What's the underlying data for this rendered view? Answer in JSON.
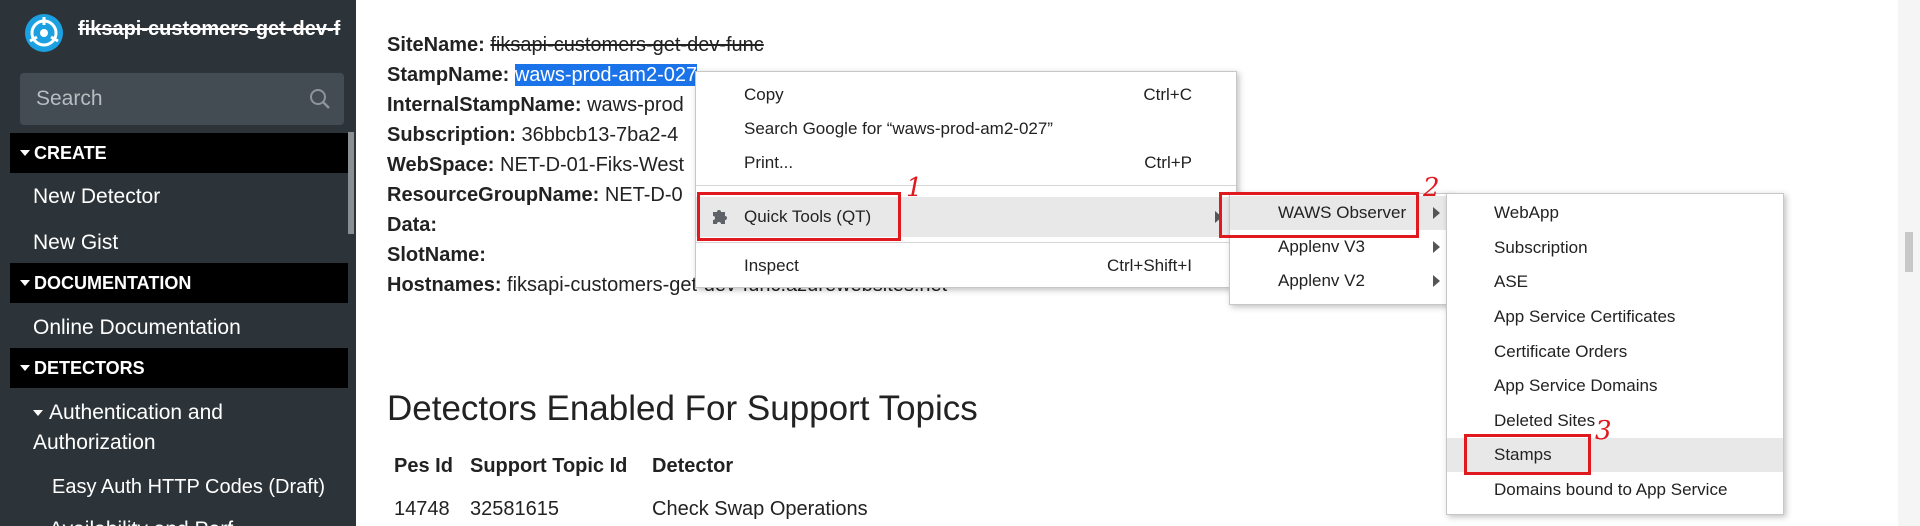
{
  "sidebar": {
    "app_title": "fiksapi-customers-get-dev-f",
    "search_placeholder": "Search",
    "create_header": "CREATE",
    "create_items": [
      "New Detector",
      "New Gist"
    ],
    "documentation_header": "DOCUMENTATION",
    "documentation_items": [
      "Online Documentation"
    ],
    "detectors_header": "DETECTORS",
    "auth_group_line1": "Authentication and",
    "auth_group_line2": "Authorization",
    "auth_child": "Easy Auth HTTP Codes (Draft)",
    "next_group_partial": "Availability and Perf"
  },
  "details": {
    "site_name_label": "SiteName:",
    "site_name_value": "fiksapi-customers-get-dev-func",
    "stamp_name_label": "StampName:",
    "stamp_name_value": "waws-prod-am2-027",
    "internal_stamp_label": "InternalStampName:",
    "internal_stamp_value": "waws-prod",
    "subscription_label": "Subscription:",
    "subscription_value": "36bbcb13-7ba2-4",
    "webspace_label": "WebSpace:",
    "webspace_value": "NET-D-01-Fiks-West",
    "rg_label": "ResourceGroupName:",
    "rg_value": "NET-D-0",
    "data_label": "Data:",
    "slot_label": "SlotName:",
    "hostnames_label": "Hostnames:",
    "hostnames_value": "fiksapi-customers-get-dev-func.azurewebsites.net"
  },
  "support_topics": {
    "title": "Detectors Enabled For Support Topics",
    "columns": [
      "Pes Id",
      "Support Topic Id",
      "Detector"
    ],
    "rows": [
      [
        "14748",
        "32581615",
        "Check Swap Operations"
      ]
    ]
  },
  "context_menu": {
    "copy": "Copy",
    "copy_shortcut": "Ctrl+C",
    "search_google": "Search Google for “waws-prod-am2-027”",
    "print": "Print...",
    "print_shortcut": "Ctrl+P",
    "quick_tools": "Quick Tools (QT)",
    "inspect": "Inspect",
    "inspect_shortcut": "Ctrl+Shift+I"
  },
  "submenu_qt": [
    "WAWS Observer",
    "Applenv V3",
    "Applenv V2"
  ],
  "submenu_waws": [
    "WebApp",
    "Subscription",
    "ASE",
    "App Service Certificates",
    "Certificate Orders",
    "App Service Domains",
    "Deleted Sites",
    "Stamps",
    "Domains bound to App Service"
  ],
  "annotations": [
    "1",
    "2",
    "3"
  ],
  "colors": {
    "sidebar_bg": "#2d3439",
    "selection": "#1a73e8",
    "annotation_red": "#e0191f",
    "menu_hover": "#e8e8e8"
  }
}
